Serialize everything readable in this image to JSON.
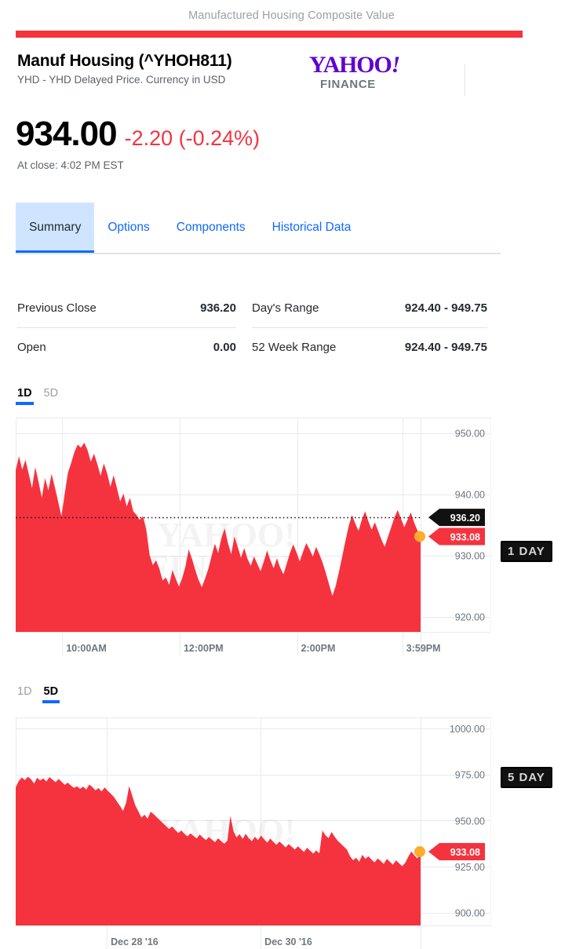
{
  "banner": {
    "title": "Manufactured Housing Composite Value",
    "rule_color": "#f5333f"
  },
  "header": {
    "quote_name": "Manuf Housing (^YHOH811)",
    "quote_subtitle": "YHD - YHD Delayed Price. Currency in USD",
    "logo": {
      "primary": "YAHOO",
      "bang": "!",
      "secondary": "FINANCE",
      "color": "#5f01d1"
    }
  },
  "quote": {
    "price": "934.00",
    "change": "-2.20 (-0.24%)",
    "change_color": "#f5333f",
    "market_time": "At close: 4:02 PM EST"
  },
  "tabs": [
    {
      "label": "Summary",
      "active": true
    },
    {
      "label": "Options",
      "active": false
    },
    {
      "label": "Components",
      "active": false
    },
    {
      "label": "Historical Data",
      "active": false
    }
  ],
  "summary": {
    "left": [
      {
        "label": "Previous Close",
        "value": "936.20"
      },
      {
        "label": "Open",
        "value": "0.00"
      }
    ],
    "right": [
      {
        "label": "Day's Range",
        "value": "924.40 - 949.75"
      },
      {
        "label": "52 Week Range",
        "value": "924.40 - 949.75"
      }
    ]
  },
  "range_switch_1d": [
    {
      "label": "1D",
      "active": true
    },
    {
      "label": "5D",
      "active": false
    }
  ],
  "range_switch_5d": [
    {
      "label": "1D",
      "active": false
    },
    {
      "label": "5D",
      "active": true
    }
  ],
  "annotations": [
    {
      "label": "1 DAY"
    },
    {
      "label": "5 DAY"
    }
  ],
  "chart_data": [
    {
      "id": "chart-1d",
      "type": "area",
      "title": "",
      "range_label": "1D",
      "xlabel": "",
      "ylabel": "",
      "grid": true,
      "legend": "none",
      "series_color": "#f5333f",
      "ylim": [
        917.5,
        952.5
      ],
      "yticks": [
        950.0,
        940.0,
        930.0,
        920.0
      ],
      "ytick_labels": [
        "950.00",
        "940.00",
        "930.00",
        "920.00"
      ],
      "xticks": [
        "10:00AM",
        "12:00PM",
        "2:00PM",
        "3:59PM"
      ],
      "xtick_positions": [
        0.115,
        0.405,
        0.695,
        0.955
      ],
      "previous_close": 936.2,
      "previous_close_label": "936.20",
      "last_price": 933.08,
      "last_price_label": "933.08",
      "marker_color": "#ffab2e",
      "values": [
        943.9,
        946.2,
        944.0,
        945.6,
        943.3,
        941.0,
        944.4,
        942.0,
        939.4,
        942.6,
        940.6,
        943.3,
        941.1,
        938.8,
        936.4,
        940.0,
        943.5,
        945.1,
        946.9,
        948.1,
        947.6,
        948.4,
        947.2,
        945.3,
        946.6,
        944.9,
        943.0,
        945.0,
        943.4,
        941.2,
        943.1,
        941.0,
        938.8,
        940.1,
        938.0,
        939.4,
        937.2,
        936.6,
        935.8,
        936.4,
        934.2,
        930.1,
        928.4,
        929.2,
        927.8,
        925.9,
        926.4,
        925.2,
        927.6,
        926.2,
        924.9,
        926.3,
        928.2,
        931.0,
        929.4,
        927.6,
        926.0,
        924.8,
        926.2,
        927.8,
        929.9,
        931.9,
        930.4,
        932.8,
        934.4,
        932.0,
        930.2,
        933.1,
        931.4,
        929.6,
        931.2,
        929.4,
        928.3,
        929.8,
        928.6,
        927.4,
        929.0,
        930.8,
        929.2,
        927.9,
        929.5,
        928.0,
        926.9,
        928.6,
        930.4,
        931.8,
        930.5,
        929.0,
        930.6,
        932.0,
        931.0,
        929.8,
        931.4,
        930.2,
        928.8,
        927.1,
        925.2,
        923.4,
        925.0,
        927.3,
        929.8,
        932.4,
        934.8,
        936.6,
        935.2,
        934.0,
        935.8,
        937.2,
        935.6,
        934.2,
        935.4,
        934.0,
        932.6,
        931.4,
        933.0,
        934.6,
        936.2,
        937.4,
        936.0,
        934.6,
        935.8,
        937.0,
        935.4,
        934.1,
        933.08
      ]
    },
    {
      "id": "chart-5d",
      "type": "area",
      "title": "",
      "range_label": "5D",
      "xlabel": "",
      "ylabel": "",
      "grid": true,
      "legend": "none",
      "series_color": "#f5333f",
      "ylim": [
        893,
        1006
      ],
      "yticks": [
        1000.0,
        975.0,
        950.0,
        925.0,
        900.0
      ],
      "ytick_labels": [
        "1000.00",
        "975.00",
        "950.00",
        "925.00",
        "900.00"
      ],
      "xticks": [
        "Dec 28 '16",
        "Dec 30 '16"
      ],
      "xtick_positions": [
        0.225,
        0.605
      ],
      "last_price": 933.08,
      "last_price_label": "933.08",
      "marker_color": "#ffab2e",
      "values": [
        968.0,
        971.5,
        973.4,
        972.0,
        973.8,
        972.4,
        970.1,
        973.2,
        971.8,
        972.9,
        971.2,
        973.6,
        972.2,
        970.8,
        972.6,
        971.0,
        969.4,
        970.6,
        969.0,
        967.8,
        968.6,
        967.2,
        968.4,
        966.8,
        969.6,
        968.2,
        966.4,
        967.6,
        965.8,
        968.0,
        966.2,
        964.6,
        962.8,
        960.4,
        957.9,
        955.2,
        959.6,
        968.8,
        963.4,
        958.2,
        955.0,
        951.6,
        953.2,
        951.0,
        954.8,
        953.4,
        951.8,
        950.2,
        948.6,
        947.0,
        945.4,
        946.8,
        944.9,
        943.2,
        944.6,
        942.8,
        941.4,
        943.0,
        941.6,
        940.2,
        942.4,
        940.8,
        939.4,
        941.0,
        939.6,
        938.2,
        940.4,
        938.8,
        937.4,
        939.0,
        952.6,
        944.2,
        940.8,
        942.6,
        940.0,
        942.8,
        940.4,
        938.8,
        941.2,
        939.4,
        941.8,
        939.8,
        938.0,
        940.2,
        938.4,
        936.8,
        938.6,
        937.0,
        935.4,
        937.2,
        935.8,
        934.2,
        936.0,
        934.4,
        933.0,
        935.2,
        933.6,
        932.0,
        933.8,
        932.2,
        944.6,
        942.0,
        940.4,
        943.8,
        941.2,
        939.0,
        937.4,
        935.8,
        934.2,
        930.6,
        928.4,
        929.8,
        927.6,
        931.4,
        929.2,
        930.6,
        928.8,
        927.2,
        929.4,
        928.0,
        926.4,
        929.2,
        927.6,
        926.0,
        928.4,
        926.8,
        925.2,
        927.0,
        930.4,
        933.2,
        931.0,
        929.4,
        933.08
      ]
    }
  ],
  "watermark": {
    "line1": "YAHOO!",
    "line2": "FINANCE"
  }
}
